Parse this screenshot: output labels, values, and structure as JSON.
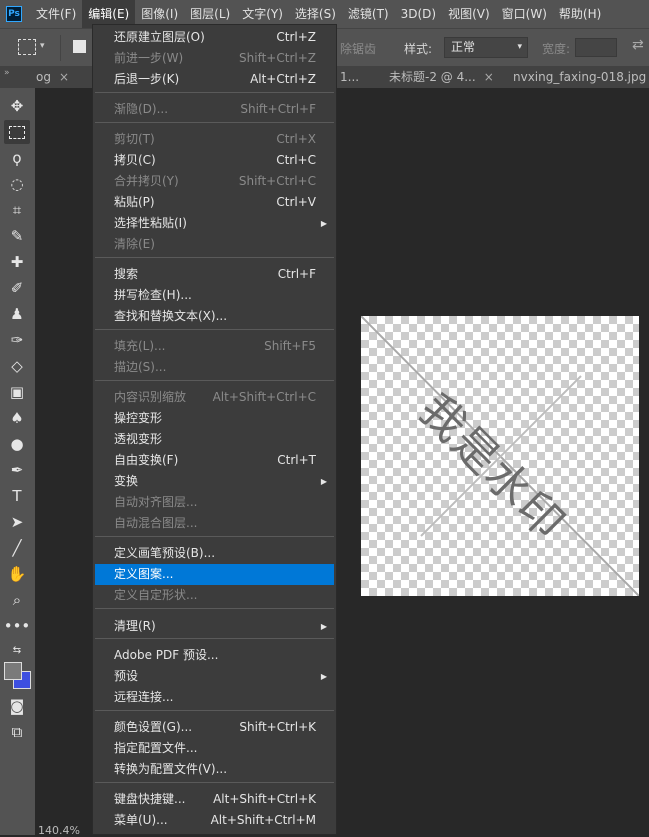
{
  "menubar": {
    "logo": "Ps",
    "items": [
      "文件(F)",
      "编辑(E)",
      "图像(I)",
      "图层(L)",
      "文字(Y)",
      "选择(S)",
      "滤镜(T)",
      "3D(D)",
      "视图(V)",
      "窗口(W)",
      "帮助(H)"
    ]
  },
  "options": {
    "remove_label": "除锯齿",
    "style_label": "样式:",
    "style_value": "正常",
    "width_label": "宽度:"
  },
  "tabs": [
    "og",
    "1...",
    "未标题-2 @ 4...",
    "nvxing_faxing-018.jpg"
  ],
  "canvas": {
    "watermark": "我是水印"
  },
  "status": {
    "zoom": "140.4%"
  },
  "edit_menu": {
    "items": [
      {
        "label": "还原建立图层(O)",
        "shortcut": "Ctrl+Z",
        "disabled": false
      },
      {
        "label": "前进一步(W)",
        "shortcut": "Shift+Ctrl+Z",
        "disabled": true
      },
      {
        "label": "后退一步(K)",
        "shortcut": "Alt+Ctrl+Z",
        "disabled": false
      },
      {
        "label": "渐隐(D)...",
        "shortcut": "Shift+Ctrl+F",
        "disabled": true
      },
      {
        "label": "剪切(T)",
        "shortcut": "Ctrl+X",
        "disabled": true
      },
      {
        "label": "拷贝(C)",
        "shortcut": "Ctrl+C",
        "disabled": false
      },
      {
        "label": "合并拷贝(Y)",
        "shortcut": "Shift+Ctrl+C",
        "disabled": true
      },
      {
        "label": "粘贴(P)",
        "shortcut": "Ctrl+V",
        "disabled": false
      },
      {
        "label": "选择性粘贴(I)",
        "shortcut": "",
        "disabled": false,
        "submenu": true
      },
      {
        "label": "清除(E)",
        "shortcut": "",
        "disabled": true
      },
      {
        "label": "搜索",
        "shortcut": "Ctrl+F",
        "disabled": false
      },
      {
        "label": "拼写检查(H)...",
        "shortcut": "",
        "disabled": false
      },
      {
        "label": "查找和替换文本(X)...",
        "shortcut": "",
        "disabled": false
      },
      {
        "label": "填充(L)...",
        "shortcut": "Shift+F5",
        "disabled": true
      },
      {
        "label": "描边(S)...",
        "shortcut": "",
        "disabled": true
      },
      {
        "label": "内容识别缩放",
        "shortcut": "Alt+Shift+Ctrl+C",
        "disabled": true
      },
      {
        "label": "操控变形",
        "shortcut": "",
        "disabled": false
      },
      {
        "label": "透视变形",
        "shortcut": "",
        "disabled": false
      },
      {
        "label": "自由变换(F)",
        "shortcut": "Ctrl+T",
        "disabled": false
      },
      {
        "label": "变换",
        "shortcut": "",
        "disabled": false,
        "submenu": true
      },
      {
        "label": "自动对齐图层...",
        "shortcut": "",
        "disabled": true
      },
      {
        "label": "自动混合图层...",
        "shortcut": "",
        "disabled": true
      },
      {
        "label": "定义画笔预设(B)...",
        "shortcut": "",
        "disabled": false
      },
      {
        "label": "定义图案...",
        "shortcut": "",
        "disabled": false,
        "highlighted": true
      },
      {
        "label": "定义自定形状...",
        "shortcut": "",
        "disabled": true
      },
      {
        "label": "清理(R)",
        "shortcut": "",
        "disabled": false,
        "submenu": true
      },
      {
        "label": "Adobe PDF 预设...",
        "shortcut": "",
        "disabled": false
      },
      {
        "label": "预设",
        "shortcut": "",
        "disabled": false,
        "submenu": true
      },
      {
        "label": "远程连接...",
        "shortcut": "",
        "disabled": false
      },
      {
        "label": "颜色设置(G)...",
        "shortcut": "Shift+Ctrl+K",
        "disabled": false
      },
      {
        "label": "指定配置文件...",
        "shortcut": "",
        "disabled": false
      },
      {
        "label": "转换为配置文件(V)...",
        "shortcut": "",
        "disabled": false
      },
      {
        "label": "键盘快捷键...",
        "shortcut": "Alt+Shift+Ctrl+K",
        "disabled": false
      },
      {
        "label": "菜单(U)...",
        "shortcut": "Alt+Shift+Ctrl+M",
        "disabled": false
      }
    ]
  },
  "colors": {
    "highlight": "#0078d7",
    "foreground": "#7a7a7a",
    "background": "#3d4fe0"
  }
}
